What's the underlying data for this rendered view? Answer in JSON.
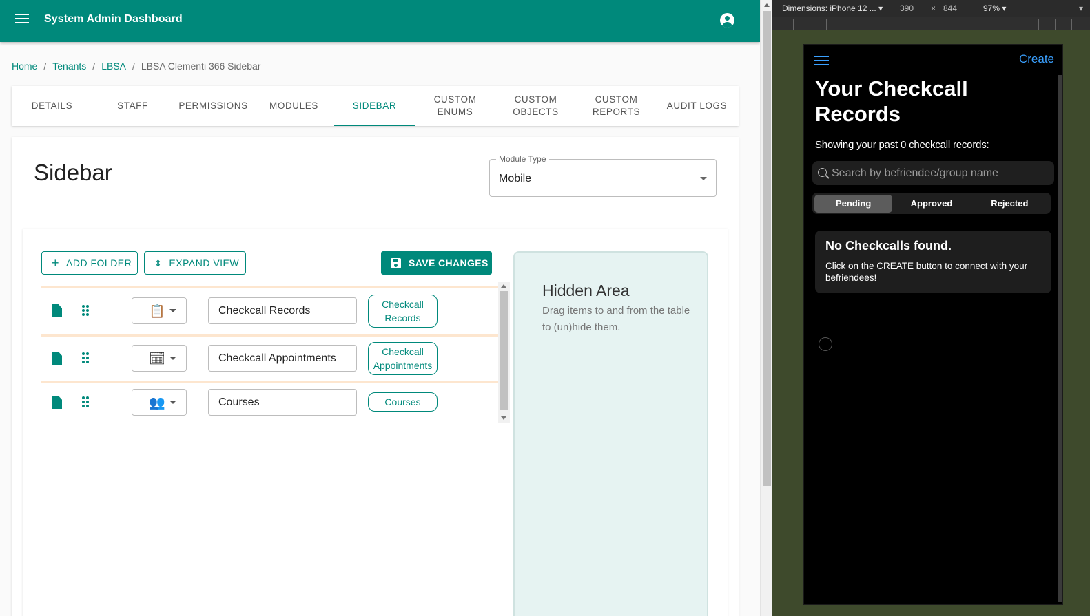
{
  "appbar": {
    "title": "System Admin Dashboard",
    "menu_icon": "hamburger-menu-icon",
    "account_icon": "account-circle-icon"
  },
  "breadcrumb": {
    "items": [
      "Home",
      "Tenants",
      "LBSA"
    ],
    "current": "LBSA Clementi 366 Sidebar"
  },
  "tabs": [
    {
      "label": "DETAILS",
      "active": false
    },
    {
      "label": "STAFF",
      "active": false
    },
    {
      "label": "PERMISSIONS",
      "active": false
    },
    {
      "label": "MODULES",
      "active": false
    },
    {
      "label": "SIDEBAR",
      "active": true
    },
    {
      "label": "CUSTOM\nENUMS",
      "active": false
    },
    {
      "label": "CUSTOM\nOBJECTS",
      "active": false
    },
    {
      "label": "CUSTOM\nREPORTS",
      "active": false
    },
    {
      "label": "AUDIT LOGS",
      "active": false
    }
  ],
  "page": {
    "title": "Sidebar",
    "module_type": {
      "label": "Module Type",
      "value": "Mobile"
    }
  },
  "toolbar": {
    "add_folder": "ADD FOLDER",
    "expand_view": "EXPAND VIEW",
    "save_changes": "SAVE CHANGES"
  },
  "sidebar_items": [
    {
      "icon": "clipboard-icon",
      "icon_glyph": "📋",
      "name": "Checkcall Records",
      "chip": "Checkcall\nRecords"
    },
    {
      "icon": "clipboard-clock-icon",
      "icon_glyph": "🗓",
      "name": "Checkcall Appointments",
      "chip": "Checkcall\nAppointments"
    },
    {
      "icon": "person-add-icon",
      "icon_glyph": "👥",
      "name": "Courses",
      "chip": "Courses"
    }
  ],
  "hidden_area": {
    "title": "Hidden Area",
    "description": "Drag items to and from the table to (un)hide them."
  },
  "devtools": {
    "dimensions": "Dimensions: iPhone 12 ... ▾",
    "width": "390",
    "times": "×",
    "height": "844",
    "zoom": "97% ▾",
    "more": "▾"
  },
  "phone": {
    "create": "Create",
    "title": "Your Checkcall Records",
    "subtitle": "Showing your past 0 checkcall records:",
    "search_placeholder": "Search by befriendee/group name",
    "segments": [
      "Pending",
      "Approved",
      "Rejected"
    ],
    "selected_segment": "Pending",
    "empty_title": "No Checkcalls found.",
    "empty_desc": "Click on the CREATE button to connect with your befriendees!"
  },
  "colors": {
    "brand": "#00897b",
    "row_separator": "#fde6cf",
    "hidden_area_bg": "#e6f3f2",
    "phone_link": "#3aa0ff"
  }
}
